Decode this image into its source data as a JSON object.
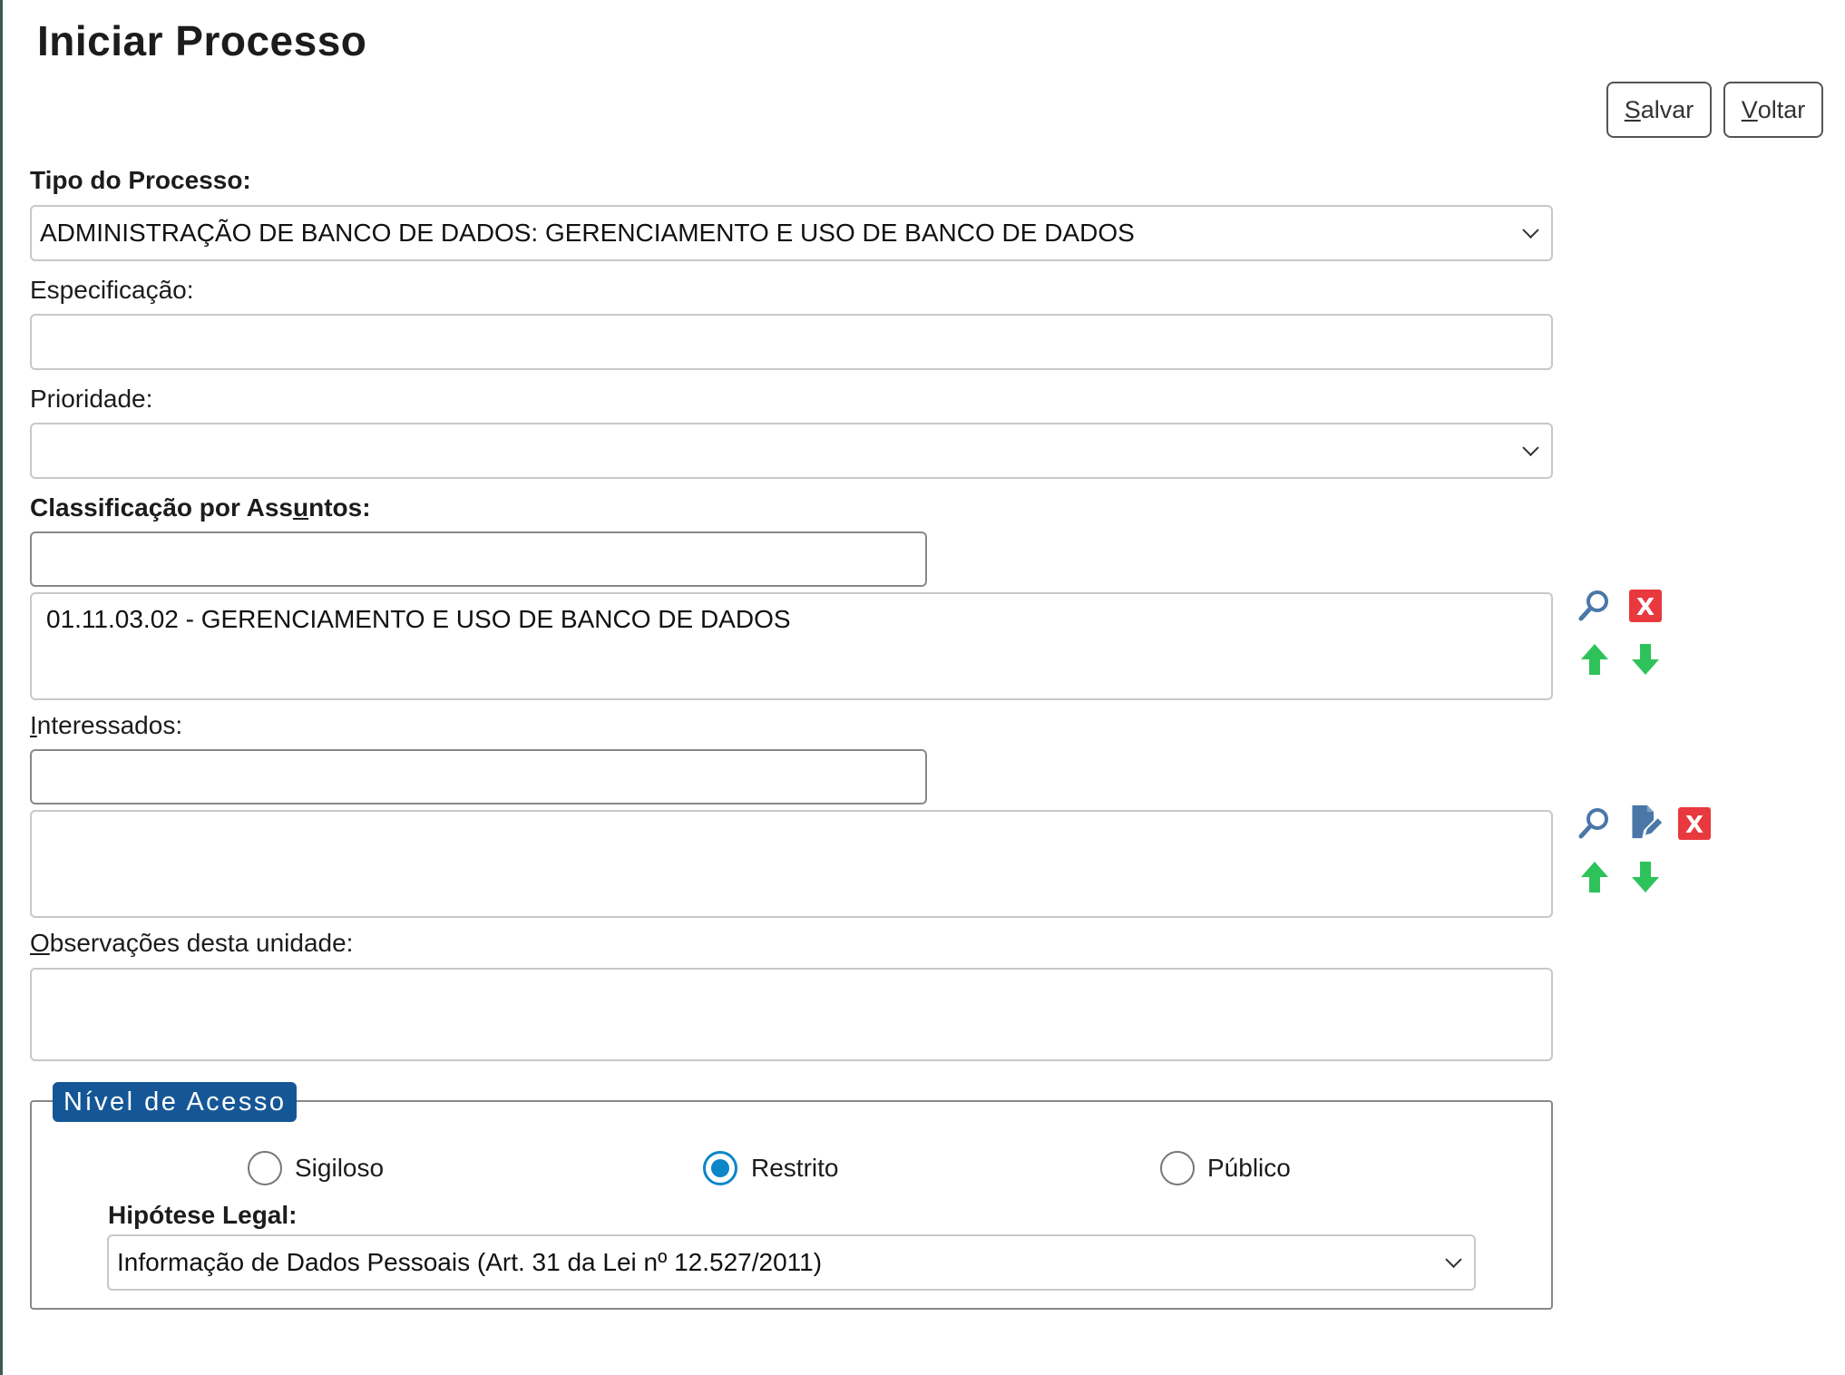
{
  "page": {
    "title": "Iniciar Processo"
  },
  "toolbar": {
    "save": {
      "prefix": "S",
      "rest": "alvar"
    },
    "back": {
      "prefix": "V",
      "rest": "oltar"
    }
  },
  "form": {
    "tipo": {
      "label": "Tipo do Processo:",
      "value": "ADMINISTRAÇÃO DE BANCO DE DADOS: GERENCIAMENTO E USO DE BANCO DE DADOS"
    },
    "especificacao": {
      "label": "Especificação:",
      "value": ""
    },
    "prioridade": {
      "label": "Prioridade:",
      "value": ""
    },
    "assuntos": {
      "label_before": "Classificação por Ass",
      "label_u": "u",
      "label_after": "ntos:",
      "search": "",
      "items": [
        "01.11.03.02 - GERENCIAMENTO E USO DE BANCO DE DADOS"
      ]
    },
    "interessados": {
      "label_u": "I",
      "label_rest": "nteressados:",
      "search": "",
      "items": []
    },
    "observacoes": {
      "label_u": "O",
      "label_rest": "bservações desta unidade:",
      "value": ""
    },
    "nivel_acesso": {
      "legend": "Nível de Acesso",
      "options": [
        {
          "label": "Sigiloso",
          "checked": false
        },
        {
          "label": "Restrito",
          "checked": true
        },
        {
          "label": "Público",
          "checked": false
        }
      ],
      "hipotese": {
        "label": "Hipótese Legal:",
        "value": "Informação de Dados Pessoais (Art. 31 da Lei nº 12.527/2011)"
      }
    }
  },
  "icons": {
    "search": "magnifier-icon",
    "remove": "remove-x-icon",
    "up": "arrow-up-icon",
    "down": "arrow-down-icon",
    "edit": "edit-document-icon"
  },
  "colors": {
    "accent_blue": "#155796",
    "radio_blue": "#0c86c8",
    "remove_red": "#e8393f",
    "arrow_green": "#2ec35a",
    "icon_blue": "#4a77a8"
  }
}
